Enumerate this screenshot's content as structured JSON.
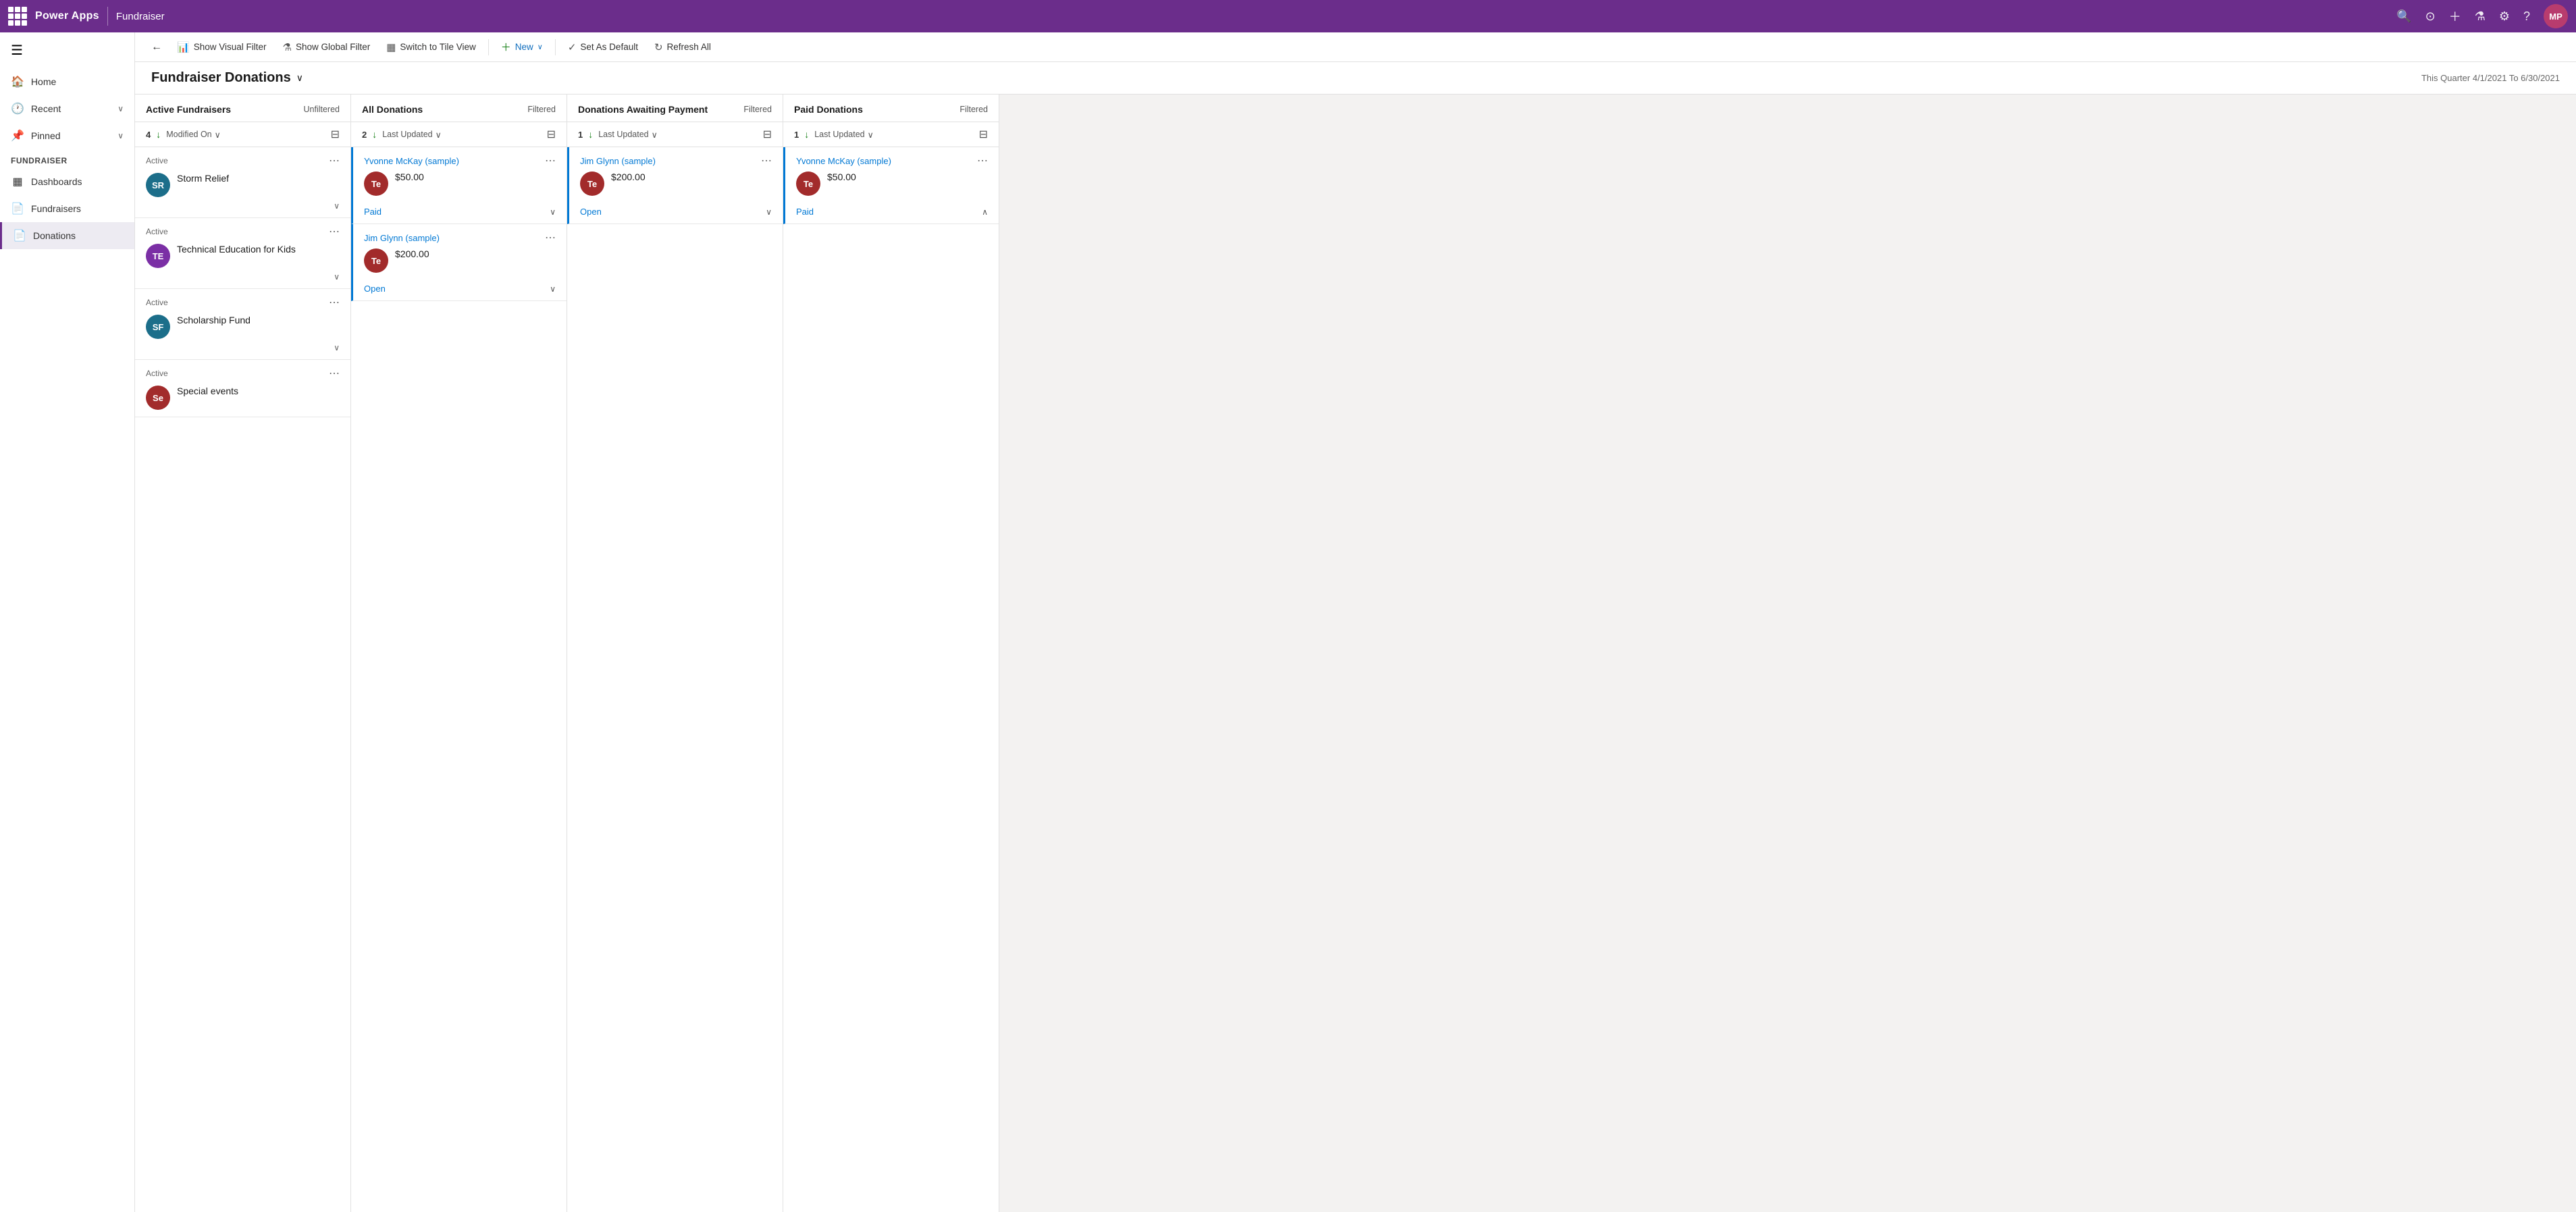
{
  "topnav": {
    "app_name": "Power Apps",
    "page_name": "Fundraiser",
    "avatar_initials": "MP",
    "avatar_bg": "#b83c6e"
  },
  "sidebar": {
    "items": [
      {
        "id": "home",
        "label": "Home",
        "icon": "🏠"
      },
      {
        "id": "recent",
        "label": "Recent",
        "icon": "🕐",
        "chevron": true
      },
      {
        "id": "pinned",
        "label": "Pinned",
        "icon": "📌",
        "chevron": true
      }
    ],
    "section": "Fundraiser",
    "nav_items": [
      {
        "id": "dashboards",
        "label": "Dashboards",
        "icon": "▦"
      },
      {
        "id": "fundraisers",
        "label": "Fundraisers",
        "icon": "🗋"
      },
      {
        "id": "donations",
        "label": "Donations",
        "icon": "🗋",
        "active": true
      }
    ]
  },
  "commandbar": {
    "back_label": "←",
    "show_visual_filter": "Show Visual Filter",
    "show_global_filter": "Show Global Filter",
    "switch_tile_view": "Switch to Tile View",
    "new_label": "New",
    "set_as_default": "Set As Default",
    "refresh_all": "Refresh All"
  },
  "page_header": {
    "title": "Fundraiser Donations",
    "subtitle": "This Quarter 4/1/2021 To 6/30/2021"
  },
  "columns": [
    {
      "id": "active-fundraisers",
      "title": "Active Fundraisers",
      "filter_label": "Unfiltered",
      "count": 4,
      "sort_label": "Modified On",
      "cards": [
        {
          "id": "storm-relief",
          "status": "Active",
          "name": "Storm Relief",
          "initials": "SR",
          "avatar_bg": "#1c6e8a"
        },
        {
          "id": "tech-edu-kids",
          "status": "Active",
          "name": "Technical Education for Kids",
          "initials": "TE",
          "avatar_bg": "#7b2fa5"
        },
        {
          "id": "scholarship-fund",
          "status": "Active",
          "name": "Scholarship Fund",
          "initials": "SF",
          "avatar_bg": "#1c6e8a"
        },
        {
          "id": "special-events",
          "status": "Active",
          "name": "Special events",
          "initials": "Se",
          "avatar_bg": "#a22b2b"
        }
      ]
    },
    {
      "id": "all-donations",
      "title": "All Donations",
      "filter_label": "Filtered",
      "count": 2,
      "sort_label": "Last Updated",
      "cards": [
        {
          "id": "donation-1",
          "donor": "Yvonne McKay (sample)",
          "amount": "$50.00",
          "initials": "Te",
          "avatar_bg": "#a22b2b",
          "status_link": "Paid",
          "status_type": "paid"
        },
        {
          "id": "donation-2",
          "donor": "Jim Glynn (sample)",
          "amount": "$200.00",
          "initials": "Te",
          "avatar_bg": "#a22b2b",
          "status_link": "Open",
          "status_type": "open"
        }
      ]
    },
    {
      "id": "donations-awaiting",
      "title": "Donations Awaiting Payment",
      "filter_label": "Filtered",
      "count": 1,
      "sort_label": "Last Updated",
      "cards": [
        {
          "id": "donation-3",
          "donor": "Jim Glynn (sample)",
          "amount": "$200.00",
          "initials": "Te",
          "avatar_bg": "#a22b2b",
          "status_link": "Open",
          "status_type": "open"
        }
      ]
    },
    {
      "id": "paid-donations",
      "title": "Paid Donations",
      "filter_label": "Filtered",
      "count": 1,
      "sort_label": "Last Updated",
      "cards": [
        {
          "id": "donation-4",
          "donor": "Yvonne McKay (sample)",
          "amount": "$50.00",
          "initials": "Te",
          "avatar_bg": "#a22b2b",
          "status_link": "Paid",
          "status_type": "paid"
        }
      ]
    }
  ]
}
